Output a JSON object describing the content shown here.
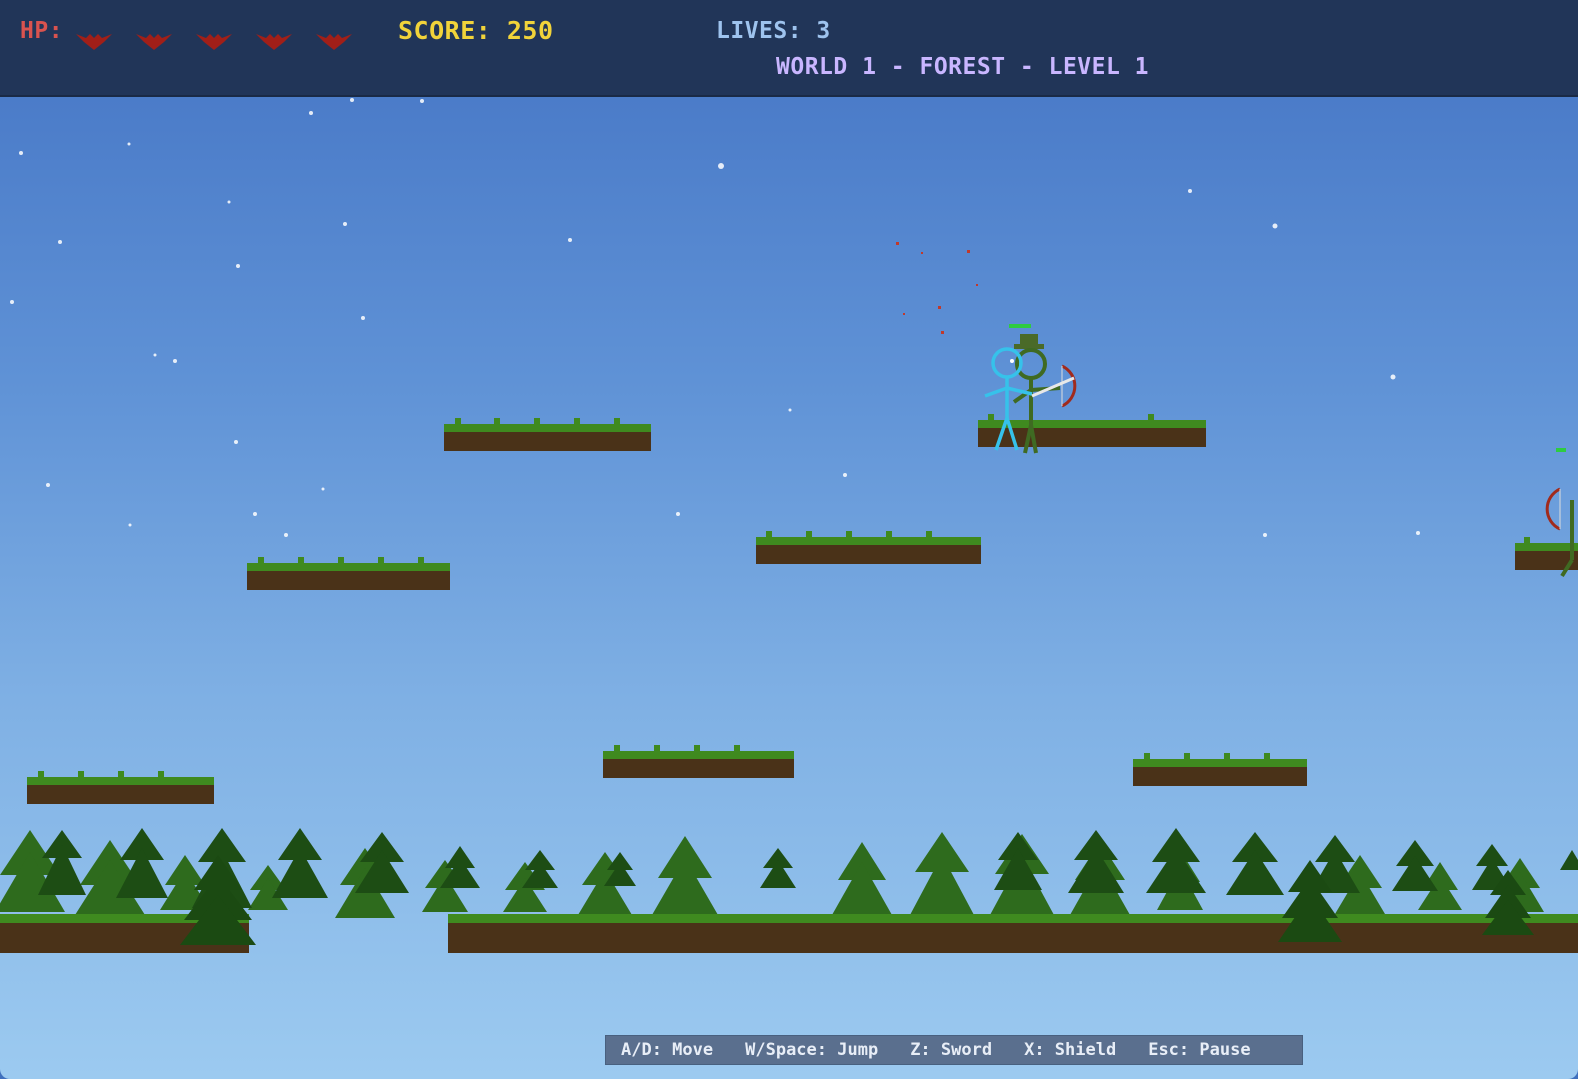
{
  "hud": {
    "hp_label": "HP:",
    "hearts": 5,
    "score": "SCORE: 250",
    "lives": "LIVES: 3",
    "world": "WORLD 1 - FOREST - LEVEL 1"
  },
  "controls": [
    "A/D: Move",
    "W/Space: Jump",
    "Z: Sword",
    "X: Shield",
    "Esc: Pause"
  ],
  "icons": {
    "heart": "winged-heart-icon",
    "tree": "pine-tree-icon"
  },
  "colors": {
    "hud_bg": "#213558",
    "hp": "#d9534f",
    "score": "#f1d33a",
    "lives": "#9ec3ee",
    "world": "#c9b6ff",
    "grass": "#3f8a1f",
    "dirt": "#4a3218",
    "player": "#36c2ea",
    "enemy": "#3f6a22",
    "bow": "#a12a1c"
  }
}
